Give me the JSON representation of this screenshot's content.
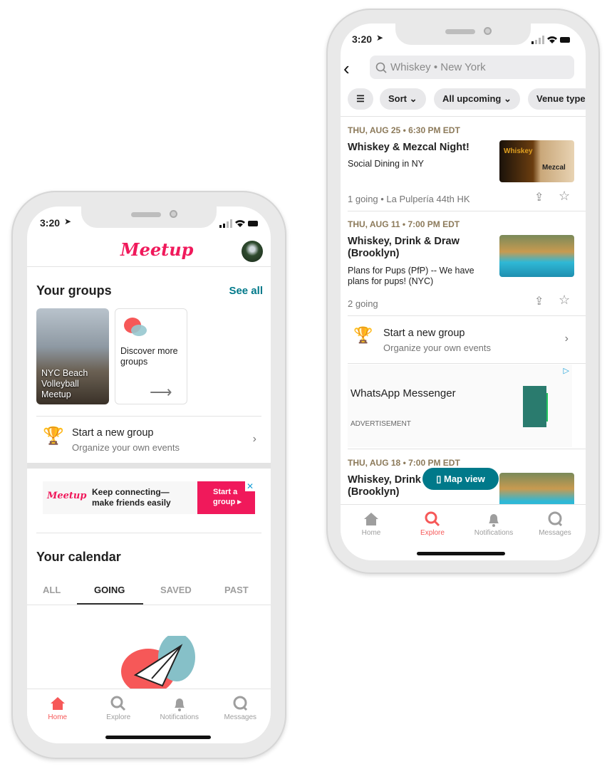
{
  "colors": {
    "brand": "#f0195b",
    "teal": "#00798a",
    "active_nav": "#f65858",
    "date": "#8c7a5a"
  },
  "left": {
    "status_time": "3:20",
    "logo": "Meetup",
    "groups_title": "Your groups",
    "see_all": "See all",
    "group_card": "NYC Beach Volleyball Meetup",
    "discover_card": "Discover more groups",
    "start_group": {
      "title": "Start a new group",
      "subtitle": "Organize your own events"
    },
    "ad": {
      "logo": "Meetup",
      "text": "Keep connecting—make friends easily",
      "cta": "Start a group ▸"
    },
    "calendar_title": "Your calendar",
    "tabs": [
      "ALL",
      "GOING",
      "SAVED",
      "PAST"
    ],
    "active_tab": "GOING",
    "nav": [
      "Home",
      "Explore",
      "Notifications",
      "Messages"
    ],
    "active_nav": "Home"
  },
  "right": {
    "status_time": "3:20",
    "search_value": "Whiskey • New York",
    "chips": [
      "Sort",
      "All upcoming",
      "Venue type"
    ],
    "events": [
      {
        "date": "THU, AUG 25 • 6:30 PM EDT",
        "title": "Whiskey & Mezcal Night!",
        "group": "Social Dining in NY",
        "meta": "1 going • La Pulpería 44th HK",
        "img_labels": [
          "Whiskey",
          "Mezcal"
        ]
      },
      {
        "date": "THU, AUG 11 • 7:00 PM EDT",
        "title": "Whiskey, Drink & Draw (Brooklyn)",
        "group": "Plans for Pups (PfP) -- We have plans for pups! (NYC)",
        "meta": "2 going"
      },
      {
        "date": "THU, AUG 18 • 7:00 PM EDT",
        "title": "Whiskey, Drink & Draw (Brooklyn)"
      }
    ],
    "start_group": {
      "title": "Start a new group",
      "subtitle": "Organize your own events"
    },
    "ad": {
      "title": "WhatsApp Messenger",
      "label": "ADVERTISEMENT"
    },
    "map_view": "Map view",
    "nav": [
      "Home",
      "Explore",
      "Notifications",
      "Messages"
    ],
    "active_nav": "Explore"
  }
}
